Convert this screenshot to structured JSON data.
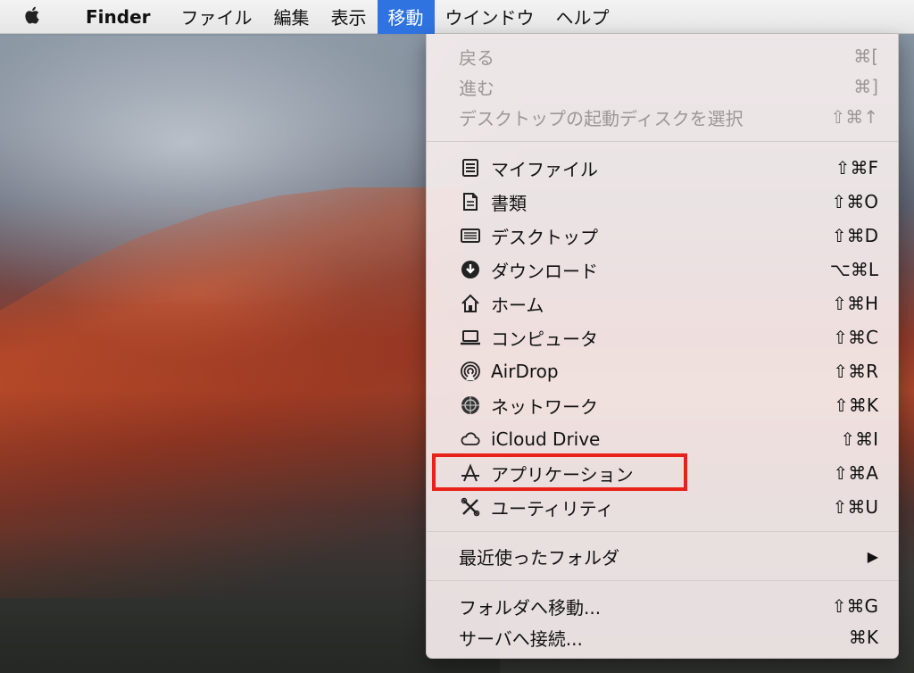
{
  "menubar": {
    "apple_icon": "apple-logo-icon",
    "items": [
      {
        "label": "Finder"
      },
      {
        "label": "ファイル"
      },
      {
        "label": "編集"
      },
      {
        "label": "表示"
      },
      {
        "label": "移動"
      },
      {
        "label": "ウインドウ"
      },
      {
        "label": "ヘルプ"
      }
    ]
  },
  "menu": {
    "items": [
      {
        "label": "戻る",
        "shortcut": "⌘[",
        "enabled": false
      },
      {
        "label": "進む",
        "shortcut": "⌘]",
        "enabled": false
      },
      {
        "label": "デスクトップの起動ディスクを選択",
        "shortcut": "⇧⌘↑",
        "enabled": false
      },
      {
        "label": "マイファイル",
        "shortcut": "⇧⌘F",
        "icon": "all-my-files-icon"
      },
      {
        "label": "書類",
        "shortcut": "⇧⌘O",
        "icon": "documents-icon"
      },
      {
        "label": "デスクトップ",
        "shortcut": "⇧⌘D",
        "icon": "desktop-icon"
      },
      {
        "label": "ダウンロード",
        "shortcut": "⌥⌘L",
        "icon": "downloads-icon"
      },
      {
        "label": "ホーム",
        "shortcut": "⇧⌘H",
        "icon": "home-icon"
      },
      {
        "label": "コンピュータ",
        "shortcut": "⇧⌘C",
        "icon": "computer-icon"
      },
      {
        "label": "AirDrop",
        "shortcut": "⇧⌘R",
        "icon": "airdrop-icon"
      },
      {
        "label": "ネットワーク",
        "shortcut": "⇧⌘K",
        "icon": "network-icon"
      },
      {
        "label": "iCloud Drive",
        "shortcut": "⇧⌘I",
        "icon": "icloud-icon"
      },
      {
        "label": "アプリケーション",
        "shortcut": "⇧⌘A",
        "icon": "applications-icon"
      },
      {
        "label": "ユーティリティ",
        "shortcut": "⇧⌘U",
        "icon": "utilities-icon"
      },
      {
        "label": "最近使ったフォルダ",
        "shortcut": "▶"
      },
      {
        "label": "フォルダへ移動...",
        "shortcut": "⇧⌘G"
      },
      {
        "label": "サーバへ接続...",
        "shortcut": "⌘K"
      }
    ]
  },
  "colors": {
    "menubar_active": "#2f73e0",
    "highlight_box": "#e8221a"
  }
}
